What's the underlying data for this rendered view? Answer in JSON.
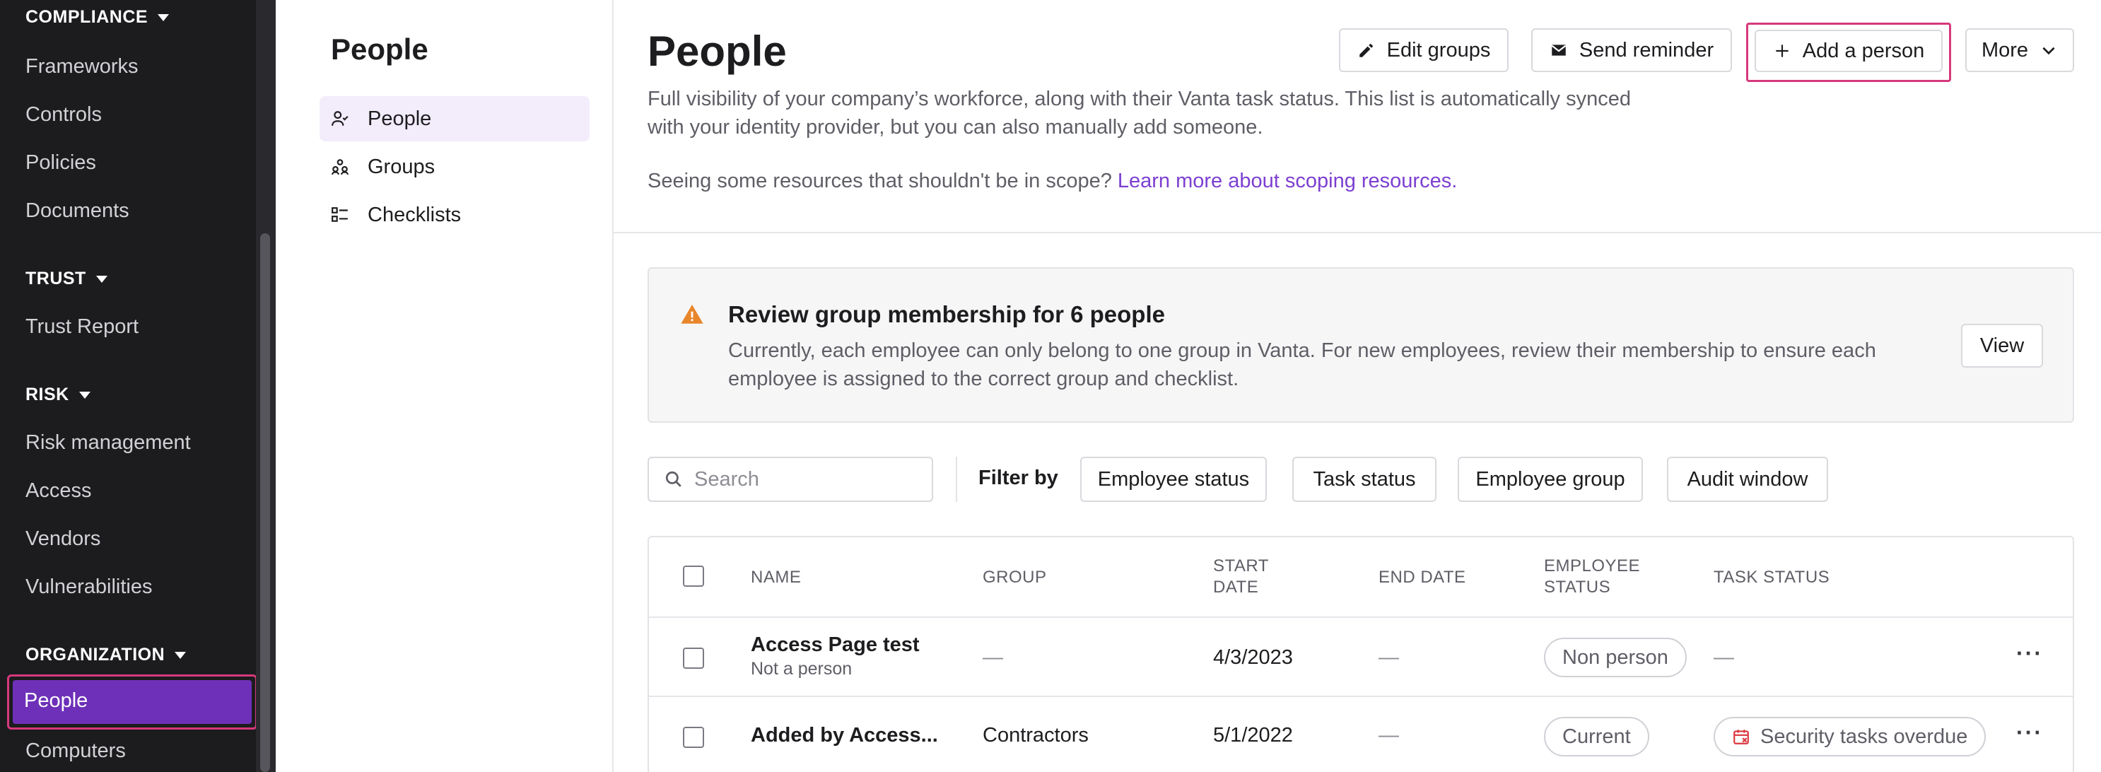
{
  "nav": {
    "sections": [
      {
        "heading": "COMPLIANCE",
        "items": [
          "Frameworks",
          "Controls",
          "Policies",
          "Documents"
        ]
      },
      {
        "heading": "TRUST",
        "items": [
          "Trust Report"
        ]
      },
      {
        "heading": "RISK",
        "items": [
          "Risk management",
          "Access",
          "Vendors",
          "Vulnerabilities"
        ]
      },
      {
        "heading": "ORGANIZATION",
        "items": [
          "People",
          "Computers"
        ]
      }
    ]
  },
  "subnav": {
    "title": "People",
    "items": [
      "People",
      "Groups",
      "Checklists"
    ]
  },
  "header": {
    "title": "People",
    "buttons": {
      "edit_groups": "Edit groups",
      "send_reminder": "Send reminder",
      "add_person": "Add a person",
      "more": "More"
    },
    "description": "Full visibility of your company’s workforce, along with their Vanta task status. This list is automatically synced with your identity provider, but you can also manually add someone.",
    "scope_text": "Seeing some resources that shouldn't be in scope? ",
    "scope_link": "Learn more about scoping resources",
    "scope_period": "."
  },
  "banner": {
    "title": "Review group membership for 6 people",
    "text": "Currently, each employee can only belong to one group in Vanta. For new employees, review their membership to ensure each employee is assigned to the correct group and checklist.",
    "button": "View"
  },
  "filters": {
    "search_placeholder": "Search",
    "label": "Filter by",
    "buttons": [
      "Employee status",
      "Task status",
      "Employee group",
      "Audit window"
    ]
  },
  "table": {
    "headers": {
      "name": "NAME",
      "group": "GROUP",
      "start_date_1": "START",
      "start_date_2": "DATE",
      "end_date": "END DATE",
      "employee_status_1": "EMPLOYEE",
      "employee_status_2": "STATUS",
      "task_status": "TASK STATUS"
    },
    "rows": [
      {
        "name": "Access Page test",
        "subtitle": "Not a person",
        "group": "—",
        "start_date": "4/3/2023",
        "end_date": "—",
        "employee_status": "Non person",
        "task_status": "—"
      },
      {
        "name": "Added by Access...",
        "subtitle": "",
        "group": "Contractors",
        "start_date": "5/1/2022",
        "end_date": "—",
        "employee_status": "Current",
        "task_status": "Security tasks overdue"
      }
    ]
  },
  "colors": {
    "nav_bg": "#1c1c1f",
    "accent": "#6e30b8",
    "highlight": "#d6397c",
    "link": "#7c3fd1",
    "warning": "#e8862a",
    "overdue": "#d9363e"
  }
}
